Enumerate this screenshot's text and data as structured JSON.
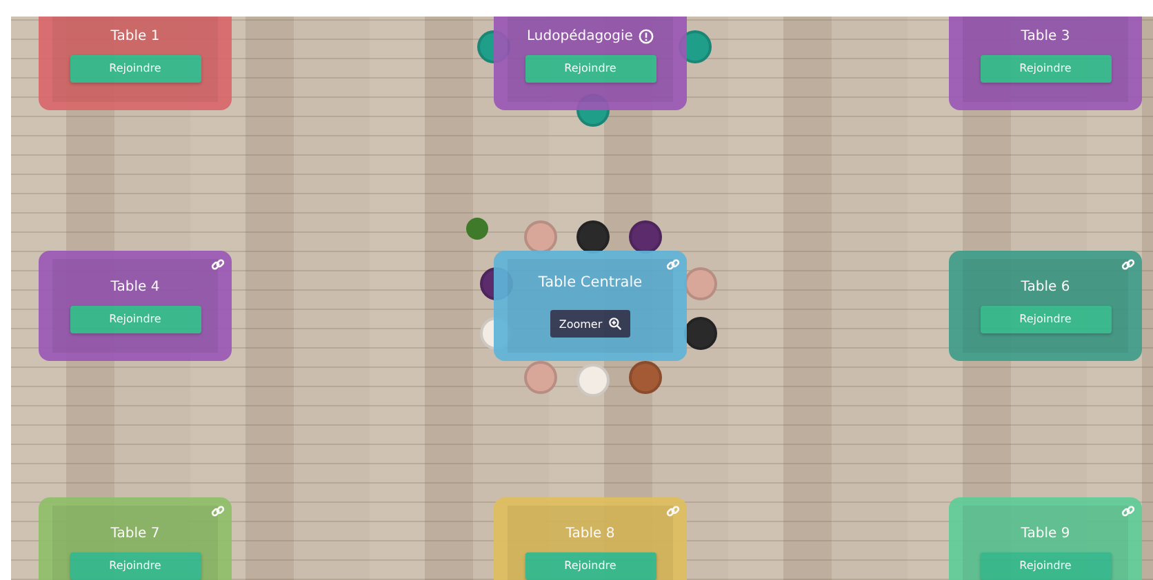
{
  "tables": [
    {
      "name": "Table 1",
      "color": "#d9686a",
      "kind": "join",
      "button": "Rejoindre",
      "link": false,
      "info": false
    },
    {
      "name": "Ludopédagogie",
      "color": "#9b59b6",
      "kind": "join",
      "button": "Rejoindre",
      "link": false,
      "info": true
    },
    {
      "name": "Table 3",
      "color": "#9b59b6",
      "kind": "join",
      "button": "Rejoindre",
      "link": false,
      "info": false
    },
    {
      "name": "Table 4",
      "color": "#9b59b6",
      "kind": "join",
      "button": "Rejoindre",
      "link": true,
      "info": false
    },
    {
      "name": "Table Centrale",
      "color": "#5fb4d9",
      "kind": "zoom",
      "button": "Zoomer",
      "link": true,
      "info": false
    },
    {
      "name": "Table 6",
      "color": "#3f9e8a",
      "kind": "join",
      "button": "Rejoindre",
      "link": true,
      "info": false
    },
    {
      "name": "Table 7",
      "color": "#8fbf6a",
      "kind": "join",
      "button": "Rejoindre",
      "link": true,
      "info": false
    },
    {
      "name": "Table 8",
      "color": "#e0bf5e",
      "kind": "join",
      "button": "Rejoindre",
      "link": true,
      "info": false
    },
    {
      "name": "Table 9",
      "color": "#5fcc98",
      "kind": "join",
      "button": "Rejoindre",
      "link": true,
      "info": false
    }
  ]
}
